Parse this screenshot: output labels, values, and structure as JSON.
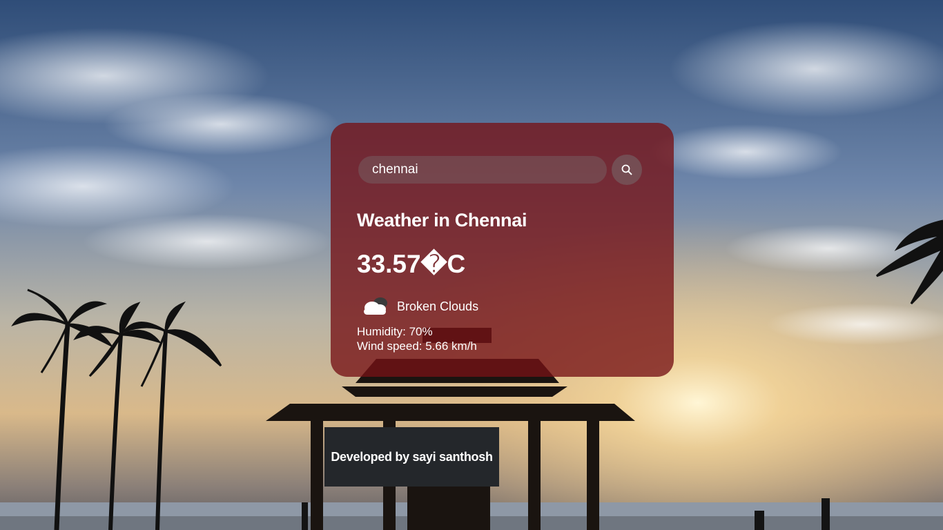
{
  "search": {
    "value": "chennai",
    "placeholder": ""
  },
  "weather": {
    "city_heading": "Weather in Chennai",
    "temperature": "33.57�C",
    "description": "Broken Clouds",
    "humidity": "Humidity: 70%",
    "wind": "Wind speed: 5.66 km/h",
    "icon": "broken-clouds-icon"
  },
  "footer": {
    "text": "Developed by sayi santhosh"
  },
  "colors": {
    "card": "#761216",
    "footer": "#24272b",
    "text": "#ffffff"
  }
}
